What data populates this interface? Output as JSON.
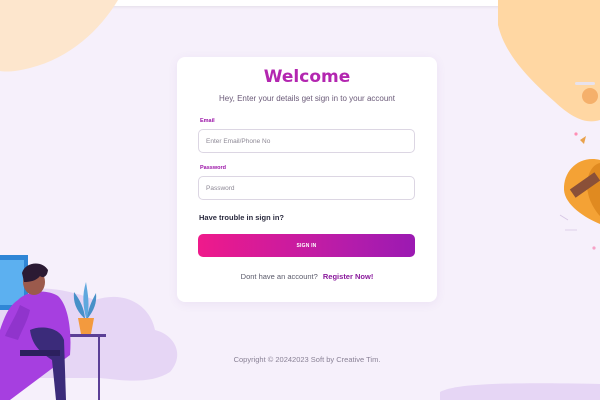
{
  "login": {
    "title": "Welcome",
    "subtitle": "Hey, Enter your details get sign in to your account",
    "email_label": "Email",
    "email_placeholder": "Enter Email/Phone No",
    "email_value": "",
    "password_label": "Password",
    "password_placeholder": "Password",
    "password_value": "",
    "trouble_text": "Have trouble in sign in?",
    "signin_label": "SIGN IN",
    "no_account_text": "Dont have an account?",
    "register_label": "Register Now!"
  },
  "footer": {
    "copyright": "Copyright © 20242023 Soft by Creative Tim."
  },
  "colors": {
    "background": "#f6f0fb",
    "title": "#b326b0",
    "label": "#9b13a7",
    "button_start": "#ef1a8b",
    "button_end": "#9b1ab2",
    "link": "#8a1a9c"
  }
}
